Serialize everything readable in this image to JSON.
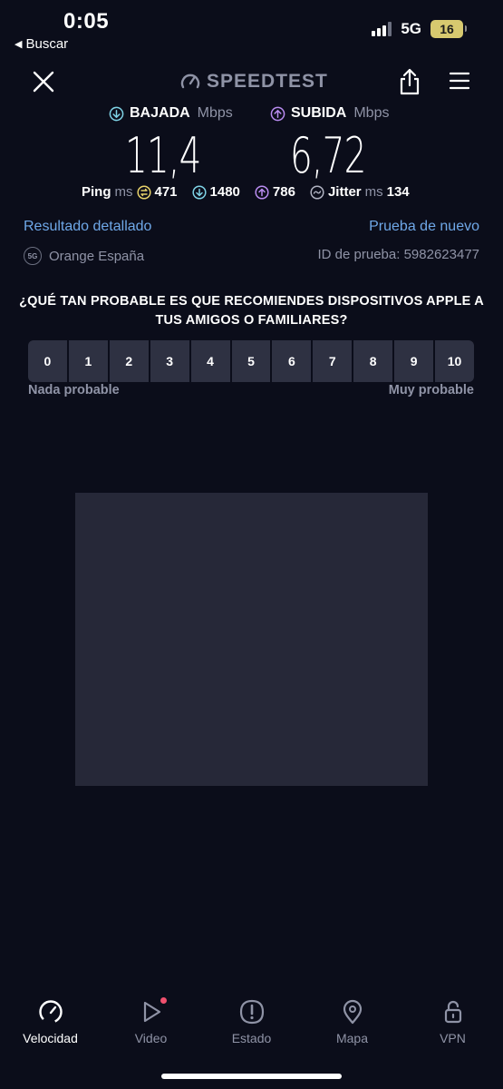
{
  "status_bar": {
    "time": "0:05",
    "back_label": "Buscar",
    "network": "5G",
    "battery": "16"
  },
  "header": {
    "logo": "SPEEDTEST"
  },
  "download": {
    "label": "BAJADA",
    "unit": "Mbps",
    "value": "11,4"
  },
  "upload": {
    "label": "SUBIDA",
    "unit": "Mbps",
    "value": "6,72"
  },
  "ping": {
    "label": "Ping",
    "unit": "ms",
    "idle": "471",
    "download": "1480",
    "upload": "786"
  },
  "jitter": {
    "label": "Jitter",
    "unit": "ms",
    "value": "134"
  },
  "links": {
    "detailed": "Resultado detallado",
    "retest": "Prueba de nuevo"
  },
  "provider": {
    "badge": "5G",
    "name": "Orange España"
  },
  "test_id": "ID de prueba: 5982623477",
  "survey": {
    "question": "¿QUÉ TAN PROBABLE ES QUE RECOMIENDES DISPOSITIVOS APPLE A TUS AMIGOS O FAMILIARES?",
    "options": [
      "0",
      "1",
      "2",
      "3",
      "4",
      "5",
      "6",
      "7",
      "8",
      "9",
      "10"
    ],
    "low_label": "Nada probable",
    "high_label": "Muy probable"
  },
  "tabs": [
    {
      "label": "Velocidad",
      "icon": "speedometer-icon",
      "active": true
    },
    {
      "label": "Video",
      "icon": "play-icon",
      "active": false
    },
    {
      "label": "Estado",
      "icon": "alert-icon",
      "active": false
    },
    {
      "label": "Mapa",
      "icon": "map-pin-icon",
      "active": false
    },
    {
      "label": "VPN",
      "icon": "lock-icon",
      "active": false
    }
  ],
  "colors": {
    "background": "#0b0d1a",
    "download_accent": "#7fd3e6",
    "upload_accent": "#b98cf0",
    "ping_accent": "#e8d26a",
    "link": "#6fa8e8"
  }
}
